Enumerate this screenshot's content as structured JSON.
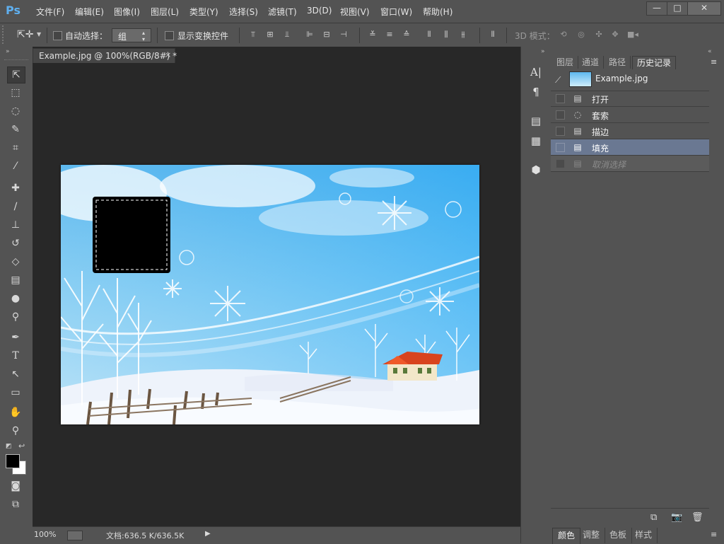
{
  "app": {
    "logo": "Ps"
  },
  "menu": [
    "文件(F)",
    "编辑(E)",
    "图像(I)",
    "图层(L)",
    "类型(Y)",
    "选择(S)",
    "滤镜(T)",
    "3D(D)",
    "视图(V)",
    "窗口(W)",
    "帮助(H)"
  ],
  "window_controls": {
    "minimize": "—",
    "restore": "□",
    "close": "✕"
  },
  "options": {
    "auto_select_label": "自动选择：",
    "auto_select_value": "组",
    "show_transform_label": "显示变换控件",
    "mode_3d_label": "3D 模式："
  },
  "document": {
    "tab_label": "Example.jpg @ 100%(RGB/8#) *",
    "close": "×"
  },
  "status": {
    "zoom": "100%",
    "doc_info": "文档:636.5 K/636.5K",
    "arrow": "▶"
  },
  "panel": {
    "tabs": [
      "图层",
      "通道",
      "路径",
      "历史记录"
    ],
    "active_tab": "历史记录",
    "snapshot_name": "Example.jpg",
    "history": [
      {
        "label": "打开",
        "icon": "document-icon",
        "state": "normal"
      },
      {
        "label": "套索",
        "icon": "lasso-icon",
        "state": "normal"
      },
      {
        "label": "描边",
        "icon": "document-icon",
        "state": "normal"
      },
      {
        "label": "填充",
        "icon": "document-icon",
        "state": "selected"
      },
      {
        "label": "取消选择",
        "icon": "document-icon",
        "state": "disabled"
      }
    ],
    "bottom_tabs": [
      "颜色",
      "调整",
      "色板",
      "样式"
    ]
  },
  "colors": {
    "selected_row": "#6a7892",
    "canvas_bg": "#282828",
    "ps_blue": "#5fb0f0"
  }
}
